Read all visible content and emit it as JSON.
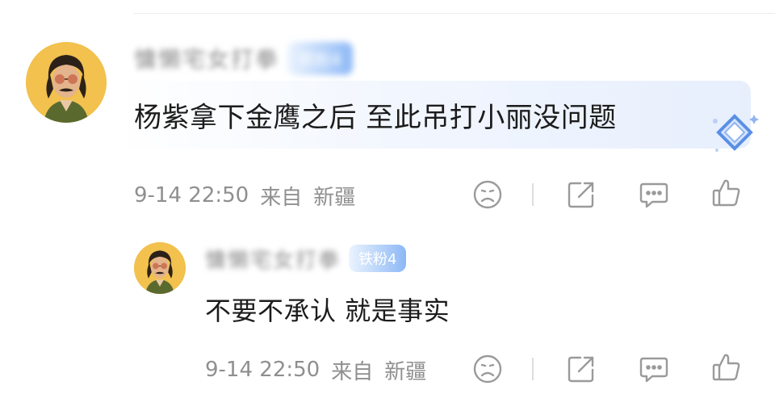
{
  "comment": {
    "username": "慵懒宅女打拳",
    "badge": "铁粉4",
    "text": "杨紫拿下金鹰之后 至此吊打小丽没问题",
    "time": "9-14 22:50",
    "from_label": "来自",
    "location": "新疆"
  },
  "reply": {
    "username": "慵懒宅女打拳",
    "badge": "铁粉4",
    "text": "不要不承认 就是事实",
    "time": "9-14 22:50",
    "from_label": "来自",
    "location": "新疆"
  },
  "colors": {
    "meta_text": "#8f8f8f",
    "icon_stroke": "#9a9a9a",
    "badge_blue": "#8cb8f6",
    "avatar_bg": "#f2c14e"
  },
  "icons": [
    "sad-face-icon",
    "share-icon",
    "comment-icon",
    "like-icon"
  ]
}
